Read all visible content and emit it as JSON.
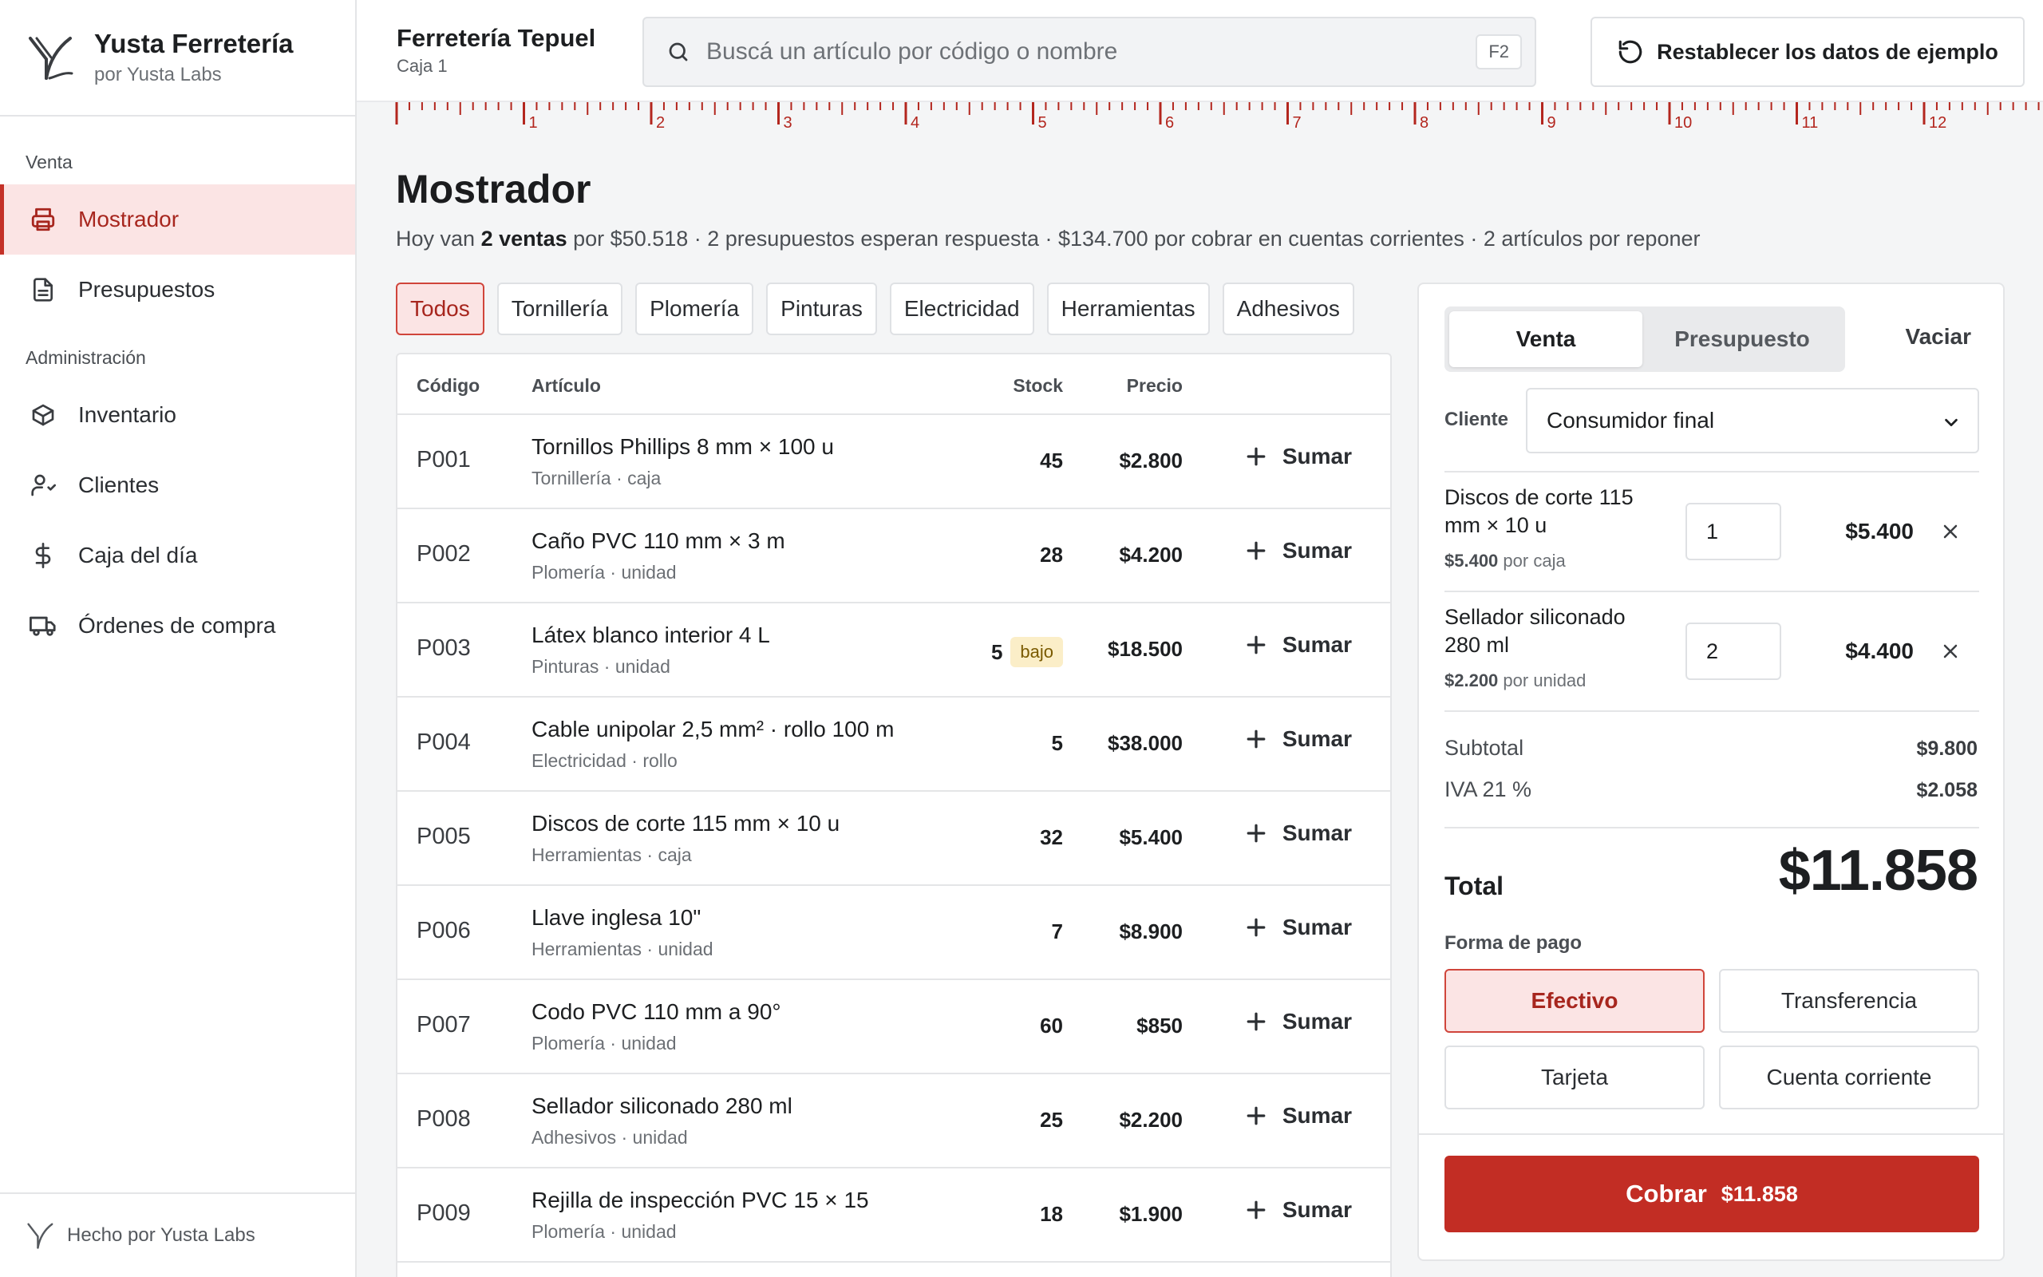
{
  "brand": {
    "name": "Yusta Ferretería",
    "sub": "por Yusta Labs"
  },
  "sidebar": {
    "sections": [
      "Venta",
      "Administración"
    ],
    "items": [
      {
        "label": "Mostrador",
        "icon": "printer-icon",
        "active": true
      },
      {
        "label": "Presupuestos",
        "icon": "document-icon"
      },
      {
        "label": "Inventario",
        "icon": "box-icon"
      },
      {
        "label": "Clientes",
        "icon": "users-icon"
      },
      {
        "label": "Caja del día",
        "icon": "dollar-icon"
      },
      {
        "label": "Órdenes de compra",
        "icon": "truck-icon"
      }
    ],
    "footer": "Hecho por Yusta Labs"
  },
  "topbar": {
    "store": "Ferretería Tepuel",
    "register": "Caja 1",
    "search_placeholder": "Buscá un artículo por código o nombre",
    "search_shortcut": "F2",
    "reset_label": "Restablecer los datos de ejemplo"
  },
  "ruler": {
    "numbers": [
      "1",
      "2",
      "3",
      "4",
      "5",
      "6",
      "7",
      "8",
      "9",
      "10",
      "11",
      "12"
    ]
  },
  "page": {
    "title": "Mostrador",
    "summary_pre": "Hoy van ",
    "summary_bold": "2 ventas",
    "summary_post": " por $50.518 · 2 presupuestos esperan respuesta · $134.700 por cobrar en cuentas corrientes · 2 artículos por reponer"
  },
  "filters": [
    "Todos",
    "Tornillería",
    "Plomería",
    "Pinturas",
    "Electricidad",
    "Herramientas",
    "Adhesivos"
  ],
  "table": {
    "headers": {
      "code": "Código",
      "item": "Artículo",
      "stock": "Stock",
      "price": "Precio"
    },
    "add_label": "Sumar",
    "rows": [
      {
        "code": "P001",
        "name": "Tornillos Phillips 8 mm × 100 u",
        "meta": "Tornillería · caja",
        "stock": "45",
        "badge": "",
        "price": "$2.800"
      },
      {
        "code": "P002",
        "name": "Caño PVC 110 mm × 3 m",
        "meta": "Plomería · unidad",
        "stock": "28",
        "badge": "",
        "price": "$4.200"
      },
      {
        "code": "P003",
        "name": "Látex blanco interior 4 L",
        "meta": "Pinturas · unidad",
        "stock": "5",
        "badge": "bajo",
        "price": "$18.500"
      },
      {
        "code": "P004",
        "name": "Cable unipolar 2,5 mm² · rollo 100 m",
        "meta": "Electricidad · rollo",
        "stock": "5",
        "badge": "",
        "price": "$38.000"
      },
      {
        "code": "P005",
        "name": "Discos de corte 115 mm × 10 u",
        "meta": "Herramientas · caja",
        "stock": "32",
        "badge": "",
        "price": "$5.400"
      },
      {
        "code": "P006",
        "name": "Llave inglesa 10\"",
        "meta": "Herramientas · unidad",
        "stock": "7",
        "badge": "",
        "price": "$8.900"
      },
      {
        "code": "P007",
        "name": "Codo PVC 110 mm a 90°",
        "meta": "Plomería · unidad",
        "stock": "60",
        "badge": "",
        "price": "$850"
      },
      {
        "code": "P008",
        "name": "Sellador siliconado 280 ml",
        "meta": "Adhesivos · unidad",
        "stock": "25",
        "badge": "",
        "price": "$2.200"
      },
      {
        "code": "P009",
        "name": "Rejilla de inspección PVC 15 × 15",
        "meta": "Plomería · unidad",
        "stock": "18",
        "badge": "",
        "price": "$1.900"
      }
    ]
  },
  "cart": {
    "mode_sale": "Venta",
    "mode_quote": "Presupuesto",
    "clear_label": "Vaciar",
    "client_label": "Cliente",
    "client_value": "Consumidor final",
    "lines": [
      {
        "name": "Discos de corte 115 mm × 10 u",
        "unit_price": "$5.400",
        "unit": "por caja",
        "qty": "1",
        "total": "$5.400"
      },
      {
        "name": "Sellador siliconado 280 ml",
        "unit_price": "$2.200",
        "unit": "por unidad",
        "qty": "2",
        "total": "$4.400"
      }
    ],
    "subtotal_label": "Subtotal",
    "subtotal": "$9.800",
    "tax_label": "IVA 21 %",
    "tax": "$2.058",
    "total_label": "Total",
    "total": "$11.858",
    "payment_label": "Forma de pago",
    "payments": [
      "Efectivo",
      "Transferencia",
      "Tarjeta",
      "Cuenta corriente"
    ],
    "charge_label": "Cobrar",
    "charge_amount": "$11.858"
  },
  "colors": {
    "accent": "#c22d24",
    "accent_soft": "#fbe4e4",
    "badge_bg": "#fbeec8"
  }
}
